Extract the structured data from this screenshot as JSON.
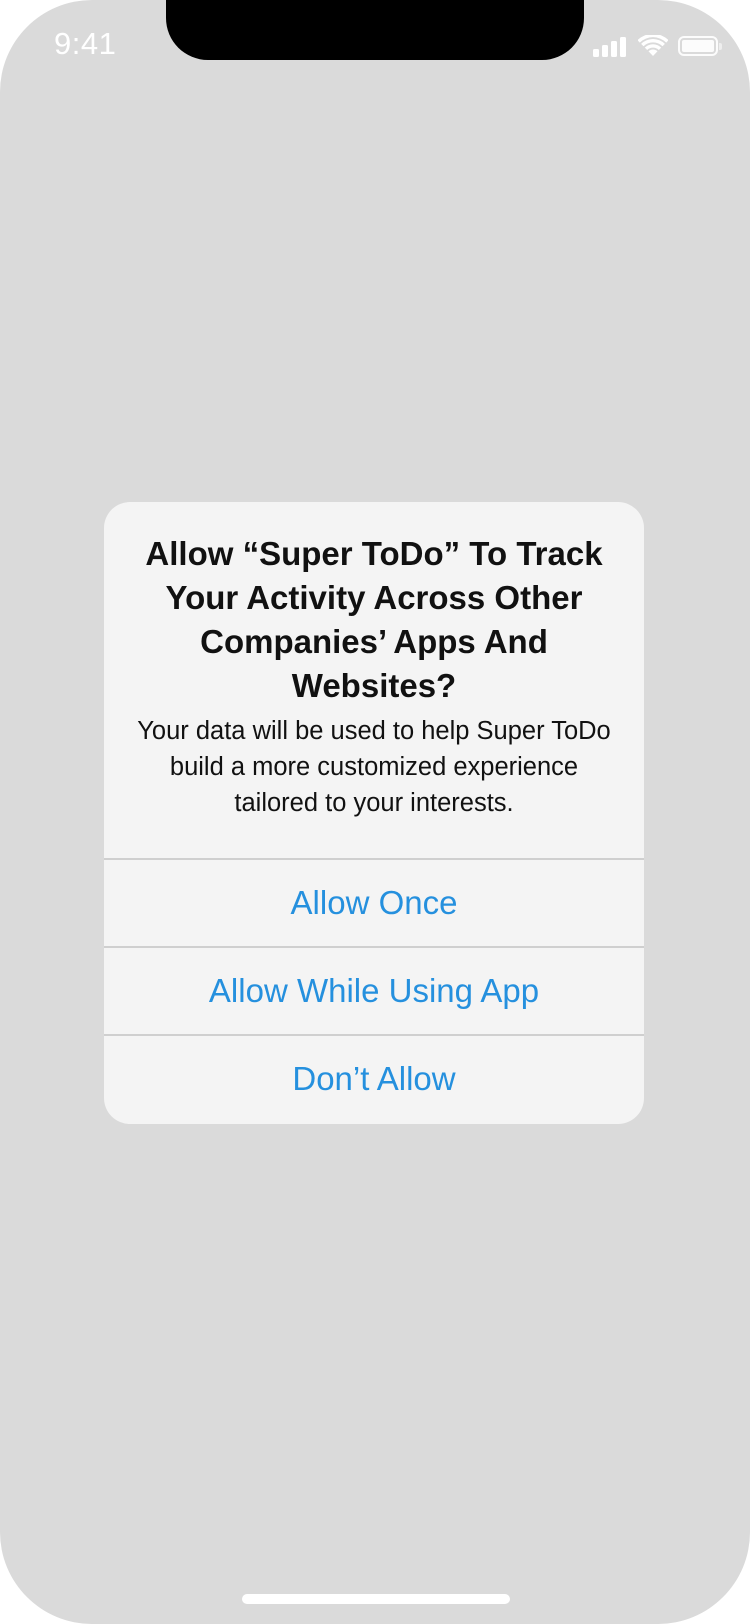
{
  "status_bar": {
    "time": "9:41",
    "icons": [
      "cellular-signal-icon",
      "wifi-icon",
      "battery-icon"
    ]
  },
  "alert": {
    "title": "Allow “Super ToDo” To Track Your Activity Across Other Companies’ Apps And Websites?",
    "message": "Your data will be used to help Super ToDo build a more customized experience tailored to your interests.",
    "buttons": [
      {
        "label": "Allow Once"
      },
      {
        "label": "Allow While Using App"
      },
      {
        "label": "Don’t Allow"
      }
    ]
  },
  "colors": {
    "background": "#dadada",
    "alert_background": "#f4f4f4",
    "button_text": "#2590de",
    "separator": "#cfcfcf"
  }
}
